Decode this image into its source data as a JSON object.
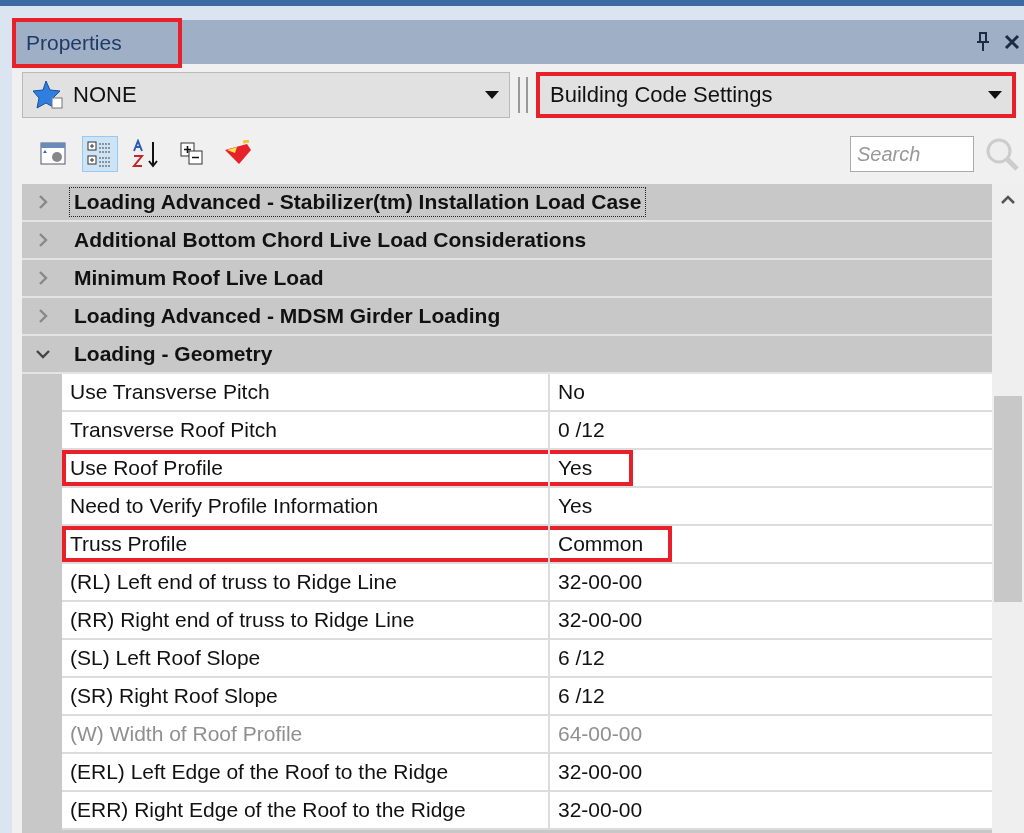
{
  "panel": {
    "title": "Properties",
    "title_highlighted": true
  },
  "selectors": [
    {
      "value": "NONE",
      "highlighted": false,
      "kind": "star"
    },
    {
      "value": "Building Code Settings",
      "highlighted": true,
      "kind": "plain"
    }
  ],
  "toolbar": {
    "buttons": [
      {
        "kind": "pages",
        "selected": false
      },
      {
        "kind": "categorized",
        "selected": true
      },
      {
        "kind": "alpha",
        "selected": false
      },
      {
        "kind": "expand",
        "selected": false
      },
      {
        "kind": "eraser",
        "selected": false
      }
    ],
    "search": {
      "placeholder": "Search"
    }
  },
  "grid": {
    "categories": [
      {
        "label": "Loading Advanced - Stabilizer(tm) Installation Load Case",
        "expanded": false,
        "focused": true
      },
      {
        "label": "Additional Bottom Chord Live Load Considerations",
        "expanded": false,
        "focused": false
      },
      {
        "label": "Minimum Roof Live Load",
        "expanded": false,
        "focused": false
      },
      {
        "label": "Loading Advanced - MDSM Girder Loading",
        "expanded": false,
        "focused": false
      },
      {
        "label": "Loading - Geometry",
        "expanded": true,
        "focused": false,
        "rows": [
          {
            "name": "Use Transverse Pitch",
            "value": "No",
            "disabled": false,
            "highlighted": false
          },
          {
            "name": "Transverse Roof Pitch",
            "value": "0 /12",
            "disabled": false,
            "highlighted": false
          },
          {
            "name": "Use Roof Profile",
            "value": "Yes",
            "disabled": false,
            "highlighted": true
          },
          {
            "name": "Need to Verify Profile Information",
            "value": "Yes",
            "disabled": false,
            "highlighted": false
          },
          {
            "name": "Truss Profile",
            "value": "Common",
            "disabled": false,
            "highlighted": true
          },
          {
            "name": "(RL) Left end of truss to Ridge Line",
            "value": "32-00-00",
            "disabled": false,
            "highlighted": false
          },
          {
            "name": "(RR) Right end of truss to Ridge Line",
            "value": "32-00-00",
            "disabled": false,
            "highlighted": false
          },
          {
            "name": "(SL) Left Roof Slope",
            "value": "6 /12",
            "disabled": false,
            "highlighted": false
          },
          {
            "name": "(SR) Right Roof Slope",
            "value": "6 /12",
            "disabled": false,
            "highlighted": false
          },
          {
            "name": "(W) Width of Roof Profile",
            "value": "64-00-00",
            "disabled": true,
            "highlighted": false
          },
          {
            "name": "(ERL) Left Edge of the Roof to the Ridge",
            "value": "32-00-00",
            "disabled": false,
            "highlighted": false
          },
          {
            "name": "(ERR) Right Edge of the Roof to the Ridge",
            "value": "32-00-00",
            "disabled": false,
            "highlighted": false
          }
        ]
      }
    ]
  }
}
